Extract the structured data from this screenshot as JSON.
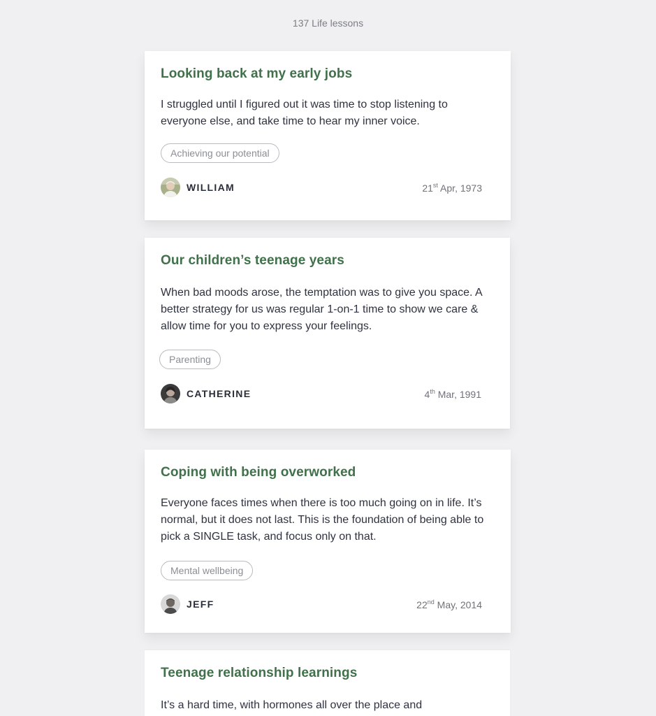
{
  "header": {
    "count_label": "137 Life lessons"
  },
  "lessons": [
    {
      "title": "Looking back at my early jobs",
      "body": "I struggled until I figured out it was time to stop listening to everyone else, and take time to hear my inner voice.",
      "tag": "Achieving our potential",
      "author": "WILLIAM",
      "date_day": "21",
      "date_suffix": "st",
      "date_rest": " Apr, 1973"
    },
    {
      "title": "Our children’s teenage years",
      "body": "When bad moods arose, the temptation was to give you space. A better strategy for us was regular 1-on-1 time to show we care & allow time for you to express your feelings.",
      "tag": "Parenting",
      "author": "CATHERINE",
      "date_day": "4",
      "date_suffix": "th",
      "date_rest": " Mar, 1991"
    },
    {
      "title": "Coping with being overworked",
      "body": "Everyone faces times when there is too much going on in life. It’s normal, but it does not last. This is the foundation of being able to pick a SINGLE task, and focus only on that.",
      "tag": "Mental wellbeing",
      "author": "JEFF",
      "date_day": "22",
      "date_suffix": "nd",
      "date_rest": " May, 2014"
    },
    {
      "title": "Teenage relationship learnings",
      "body": "It’s a hard time, with hormones all over the place and"
    }
  ]
}
